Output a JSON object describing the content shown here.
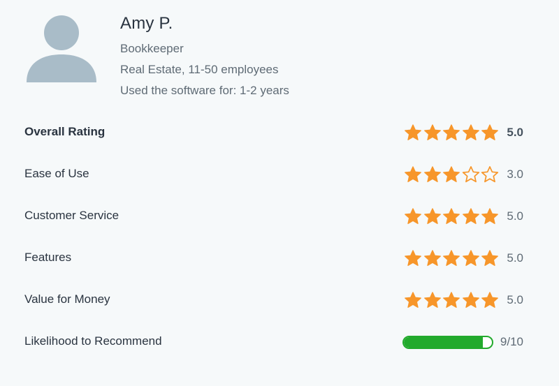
{
  "reviewer": {
    "name": "Amy P.",
    "role": "Bookkeeper",
    "industry": "Real Estate, 11-50 employees",
    "usage": "Used the software for: 1-2 years",
    "avatar_icon": "user-silhouette-icon"
  },
  "ratings": {
    "overall": {
      "label": "Overall Rating",
      "value": 5,
      "display": "5.0"
    },
    "ease_of_use": {
      "label": "Ease of Use",
      "value": 3,
      "display": "3.0"
    },
    "customer_service": {
      "label": "Customer Service",
      "value": 5,
      "display": "5.0"
    },
    "features": {
      "label": "Features",
      "value": 5,
      "display": "5.0"
    },
    "value_for_money": {
      "label": "Value for Money",
      "value": 5,
      "display": "5.0"
    }
  },
  "recommend": {
    "label": "Likelihood to Recommend",
    "value": 9,
    "max": 10,
    "display": "9/10"
  },
  "colors": {
    "star": "#f7962a",
    "star_empty_stroke": "#f7962a",
    "bar": "#22aa2c",
    "avatar": "#a9bcc8"
  }
}
